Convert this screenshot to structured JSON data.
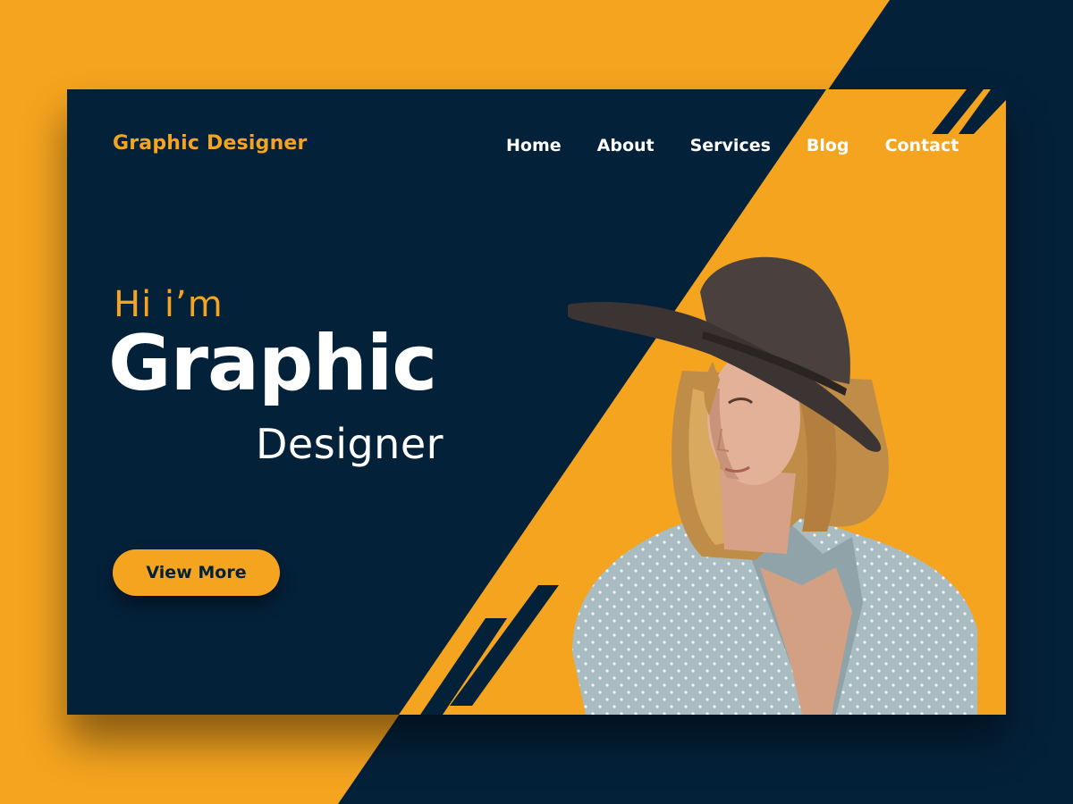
{
  "brand": {
    "logo_text": "Graphic Designer"
  },
  "nav": {
    "items": [
      {
        "label": "Home"
      },
      {
        "label": "About"
      },
      {
        "label": "Services"
      },
      {
        "label": "Blog"
      },
      {
        "label": "Contact"
      }
    ]
  },
  "hero": {
    "greeting": "Hi  i’m",
    "title": "Graphic",
    "subtitle": "Designer",
    "cta_label": "View More"
  },
  "colors": {
    "accent": "#f5a41f",
    "navy": "#04213a",
    "text_light": "#ffffff"
  },
  "images": {
    "portrait": "woman-in-hat-portrait"
  }
}
